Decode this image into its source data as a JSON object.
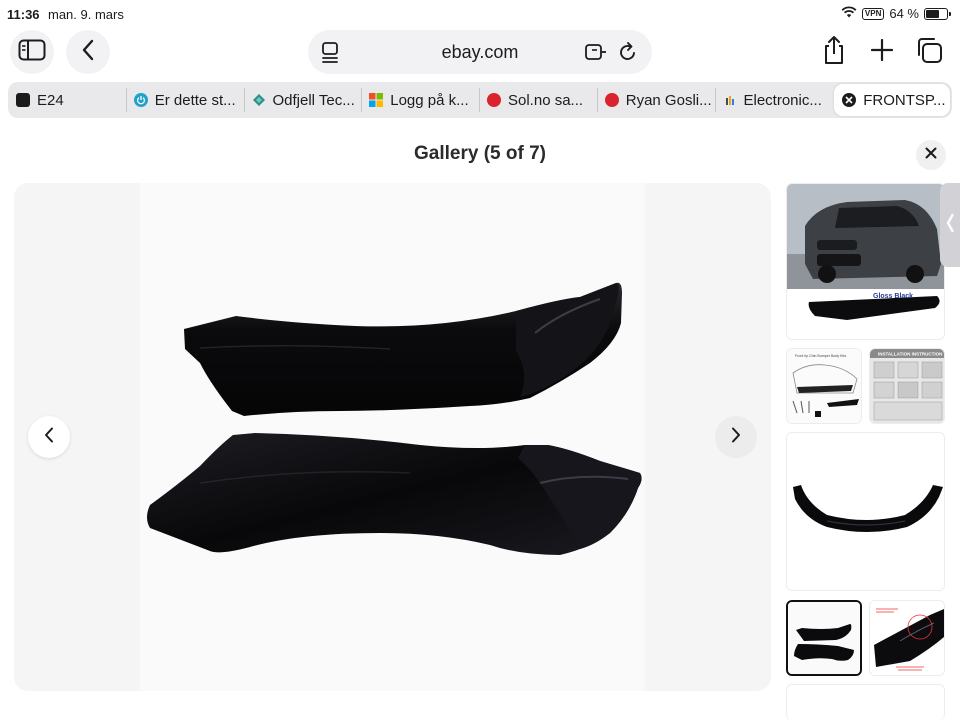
{
  "status_bar": {
    "time": "11:36",
    "date": "man. 9. mars",
    "vpn": "VPN",
    "battery_text": "64 %",
    "battery_level": 0.64
  },
  "address_bar": {
    "domain": "ebay.com"
  },
  "tabs": [
    {
      "label": "E24",
      "icon": "e24-favicon",
      "color": "#1a1a1a"
    },
    {
      "label": "Er dette st...",
      "icon": "power-favicon",
      "color": "#1fa3c9"
    },
    {
      "label": "Odfjell Tec...",
      "icon": "odfjell-favicon",
      "color": "#2f8f8a"
    },
    {
      "label": "Logg på k...",
      "icon": "microsoft-favicon",
      "color": "#f25022"
    },
    {
      "label": "Sol.no sa...",
      "icon": "sol-favicon",
      "color": "#d9232d"
    },
    {
      "label": "Ryan Gosli...",
      "icon": "sol-favicon",
      "color": "#d9232d"
    },
    {
      "label": "Electronic...",
      "icon": "bars-favicon",
      "color": "#e6a817"
    },
    {
      "label": "FRONTSP...",
      "icon": "close-circle-icon",
      "color": "#1c1c1e"
    }
  ],
  "gallery": {
    "title": "Gallery (5 of 7)",
    "selected_index": 5,
    "total": 7
  },
  "thumbnails": {
    "thumb1_caption": "Gloss Black",
    "thumb2_caption": "Front lip Chin Bumper Body Kits",
    "thumb3_caption": "INSTALLATION INSTRUCTION"
  },
  "colors": {
    "accent": "#007aff",
    "part": "#0b0b0d",
    "background": "#f5f5f5"
  }
}
